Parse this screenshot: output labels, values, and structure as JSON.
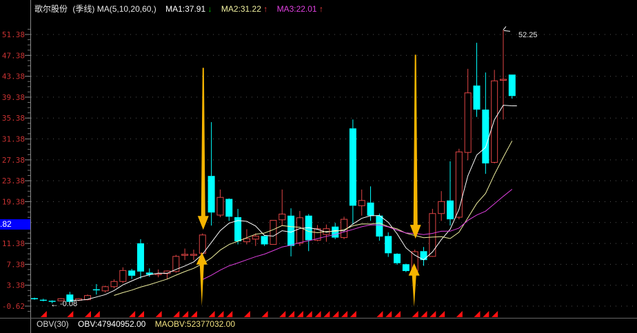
{
  "header": {
    "stock_name": "歌尔股份",
    "period": "(季线)",
    "ma_params": "MA(5,10,20,60,)",
    "ma1": "MA1:37.91",
    "ma1_dir": "↓",
    "ma2": "MA2:31.22",
    "ma2_dir": "↑",
    "ma3": "MA3:22.01",
    "ma3_dir": "↑"
  },
  "price_box": ".82",
  "obv": {
    "title": "OBV(30)",
    "obv": "OBV:47940952.00",
    "maobv": "MAOBV:52377032.00"
  },
  "colors": {
    "up": "#e04545",
    "down": "#00ffff",
    "ma5": "#ffffff",
    "ma10": "#f0f0a0",
    "ma20": "#e040e0",
    "arrow": "#f5b400",
    "axis_label": "#c83232"
  },
  "chart_data": {
    "type": "candlestick",
    "title": "歌尔股份 (季线)",
    "y_ticks": [
      "51.38",
      "47.38",
      "43.38",
      "39.38",
      "35.38",
      "31.38",
      "27.38",
      "23.38",
      "19.38",
      "15.38",
      "11.38",
      "7.38",
      "3.38",
      "-0.62"
    ],
    "ylim": [
      -0.62,
      51.38
    ],
    "grid": true,
    "ohlc": [
      [
        0.9,
        1.0,
        0.6,
        0.7
      ],
      [
        0.6,
        0.8,
        0.3,
        0.5
      ],
      [
        0.4,
        0.5,
        -0.08,
        0.2
      ],
      [
        0.4,
        0.9,
        0.3,
        0.8
      ],
      [
        1.6,
        2.1,
        0.0,
        0.2
      ],
      [
        0.5,
        0.9,
        0.3,
        0.8
      ],
      [
        0.6,
        1.6,
        0.5,
        1.4
      ],
      [
        2.6,
        3.6,
        1.6,
        2.4
      ],
      [
        2.3,
        3.3,
        2.0,
        3.1
      ],
      [
        3.1,
        4.5,
        2.8,
        4.1
      ],
      [
        4.1,
        6.8,
        3.8,
        6.2
      ],
      [
        6.2,
        6.5,
        4.6,
        5.2
      ],
      [
        11.4,
        12.2,
        4.6,
        6.0
      ],
      [
        5.8,
        6.6,
        5.0,
        5.4
      ],
      [
        5.5,
        6.4,
        4.9,
        5.6
      ],
      [
        5.6,
        6.2,
        4.6,
        6.1
      ],
      [
        6.0,
        9.2,
        5.8,
        8.9
      ],
      [
        9.2,
        10.4,
        8.2,
        9.3
      ],
      [
        9.2,
        10.2,
        8.2,
        9.3
      ],
      [
        9.5,
        13.3,
        9.0,
        13.0
      ],
      [
        24.3,
        34.6,
        14.8,
        17.3
      ],
      [
        16.8,
        21.7,
        16.4,
        20.2
      ],
      [
        19.9,
        20.0,
        15.7,
        16.5
      ],
      [
        16.4,
        18.0,
        11.2,
        11.8
      ],
      [
        11.7,
        14.1,
        11.2,
        12.3
      ],
      [
        12.2,
        13.3,
        10.9,
        12.8
      ],
      [
        12.8,
        12.9,
        10.9,
        11.2
      ],
      [
        11.2,
        15.8,
        11.2,
        15.8
      ],
      [
        15.9,
        21.7,
        14.7,
        17.0
      ],
      [
        16.7,
        18.1,
        8.9,
        10.9
      ],
      [
        11.4,
        17.6,
        10.9,
        16.3
      ],
      [
        16.7,
        17.0,
        9.9,
        12.0
      ],
      [
        12.0,
        14.9,
        11.8,
        14.2
      ],
      [
        13.1,
        15.0,
        11.7,
        14.2
      ],
      [
        14.6,
        15.3,
        12.2,
        12.5
      ],
      [
        12.5,
        16.5,
        12.2,
        16.0
      ],
      [
        33.4,
        35.1,
        15.0,
        18.6
      ],
      [
        18.6,
        21.7,
        16.7,
        19.6
      ],
      [
        19.2,
        22.3,
        15.7,
        16.7
      ],
      [
        16.7,
        17.1,
        11.9,
        12.7
      ],
      [
        12.8,
        13.5,
        8.8,
        9.5
      ],
      [
        9.4,
        9.5,
        7.3,
        7.6
      ],
      [
        7.4,
        7.5,
        5.9,
        6.1
      ],
      [
        6.1,
        10.2,
        6.1,
        9.8
      ],
      [
        9.9,
        10.7,
        7.1,
        8.2
      ],
      [
        8.9,
        18.0,
        8.8,
        17.1
      ],
      [
        17.1,
        21.4,
        15.7,
        19.4
      ],
      [
        19.6,
        27.1,
        14.8,
        16.0
      ],
      [
        16.4,
        29.5,
        16.0,
        28.9
      ],
      [
        28.8,
        44.8,
        27.3,
        40.2
      ],
      [
        41.6,
        49.8,
        35.6,
        37.0
      ],
      [
        37.0,
        44.1,
        24.7,
        26.7
      ],
      [
        26.9,
        44.6,
        26.7,
        42.5
      ],
      [
        42.8,
        52.25,
        35.1,
        42.8
      ],
      [
        43.7,
        43.7,
        39.1,
        39.6
      ]
    ],
    "ma_periods": [
      5,
      10,
      20
    ],
    "signal_candles": [
      1,
      4,
      6,
      7,
      11,
      12,
      14,
      16,
      17,
      18,
      20,
      21,
      22,
      24,
      26,
      28,
      29,
      30,
      31,
      32,
      33,
      34,
      35,
      36,
      39,
      40,
      41,
      43,
      44,
      45,
      46,
      48,
      50,
      51,
      52
    ],
    "arrows": [
      {
        "dir": "down",
        "candle": 19,
        "from": 45,
        "to": 14
      },
      {
        "dir": "up",
        "candle": 19,
        "from": -0.6,
        "to": 9.7
      },
      {
        "dir": "down",
        "candle": 43,
        "from": 47.5,
        "to": 12.3
      },
      {
        "dir": "up",
        "candle": 43,
        "from": -0.8,
        "to": 7.6
      }
    ],
    "high_label": "52.25",
    "low_label": "-0.08"
  }
}
